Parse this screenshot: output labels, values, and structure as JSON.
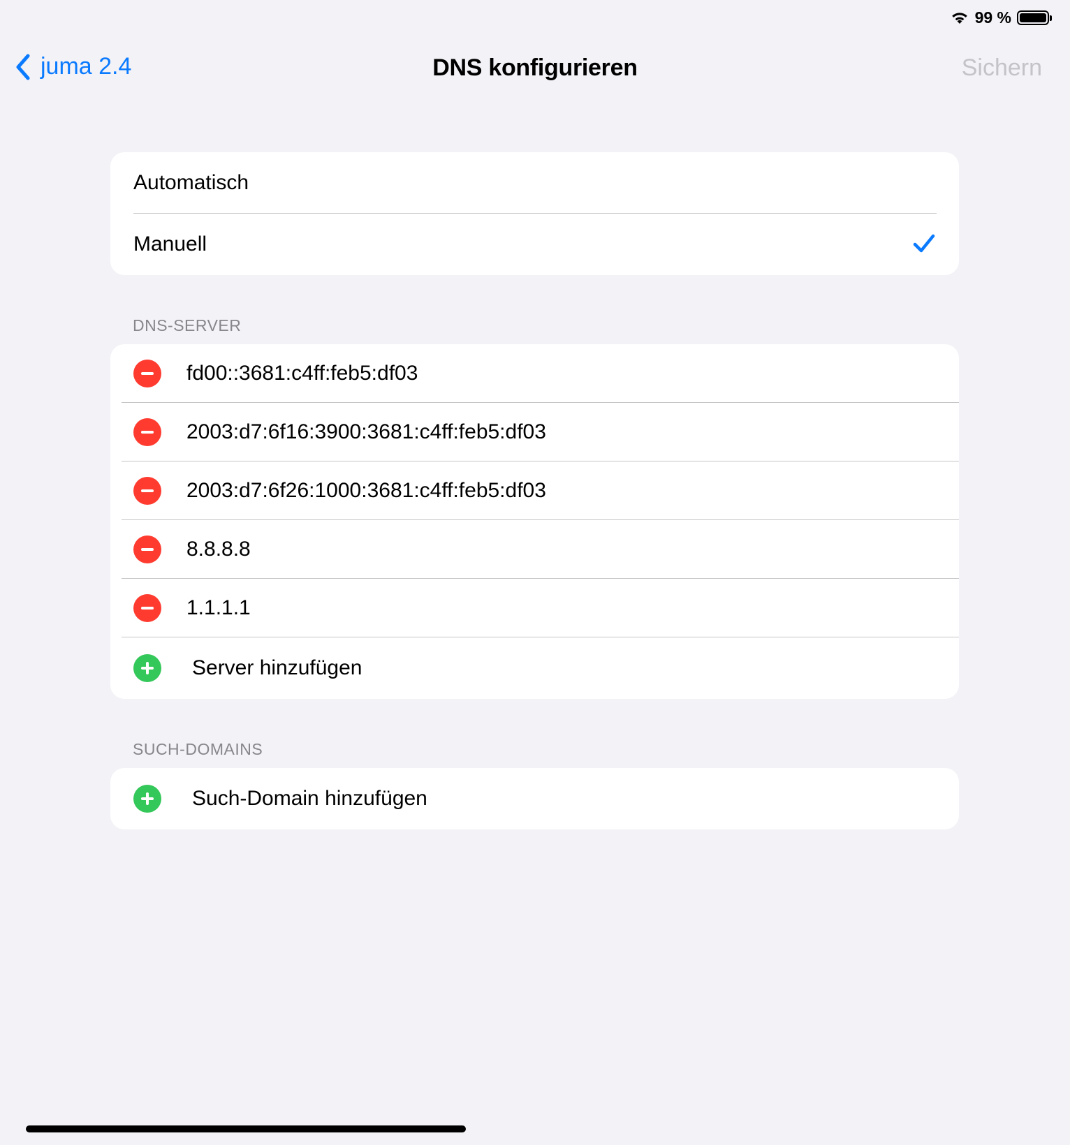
{
  "status_bar": {
    "battery_text": "99 %",
    "battery_level": 0.99
  },
  "nav": {
    "back_label": "juma 2.4",
    "title": "DNS konfigurieren",
    "save_label": "Sichern"
  },
  "mode": {
    "options": [
      "Automatisch",
      "Manuell"
    ],
    "selected": "Manuell"
  },
  "dns_servers": {
    "header": "DNS-SERVER",
    "servers": [
      "fd00::3681:c4ff:feb5:df03",
      "2003:d7:6f16:3900:3681:c4ff:feb5:df03",
      "2003:d7:6f26:1000:3681:c4ff:feb5:df03",
      "8.8.8.8",
      "1.1.1.1"
    ],
    "add_label": "Server hinzufügen"
  },
  "search_domains": {
    "header": "SUCH-DOMAINS",
    "add_label": "Such-Domain hinzufügen"
  },
  "colors": {
    "accent": "#0a7aff",
    "delete": "#ff3b30",
    "add": "#34c759",
    "background": "#f2f2f7",
    "disabled": "#c3c3c8"
  }
}
